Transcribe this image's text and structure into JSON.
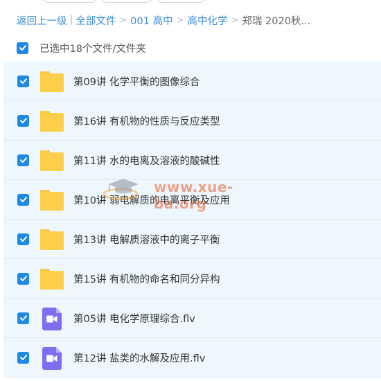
{
  "breadcrumb": {
    "back": "返回上一级",
    "all_files": "全部文件",
    "level1": "001 高中",
    "level2": "高中化学",
    "current": "郑瑞 2020秋..."
  },
  "selection": {
    "label": "已选中18个文件/文件夹"
  },
  "files": [
    {
      "name": "第09讲 化学平衡的图像综合",
      "type": "folder-icon"
    },
    {
      "name": "第16讲 有机物的性质与反应类型",
      "type": "folder-icon"
    },
    {
      "name": "第11讲 水的电离及溶液的酸碱性",
      "type": "folder-icon"
    },
    {
      "name": "第10讲 弱电解质的电离平衡及应用",
      "type": "folder-icon"
    },
    {
      "name": "第13讲 电解质溶液中的离子平衡",
      "type": "folder-icon"
    },
    {
      "name": "第15讲 有机物的命名和同分异构",
      "type": "folder-icon"
    },
    {
      "name": "第05讲 电化学原理综合.flv",
      "type": "video-file-icon"
    },
    {
      "name": "第12讲 盐类的水解及应用.flv",
      "type": "video-file-icon"
    }
  ],
  "watermark": {
    "text": "www.xue-ba.org"
  },
  "colors": {
    "accent": "#1e88e5",
    "link": "#3b8cd9",
    "row_bg": "#eef7fd",
    "folder": "#fbcf4a",
    "video": "#7d6ff0"
  }
}
